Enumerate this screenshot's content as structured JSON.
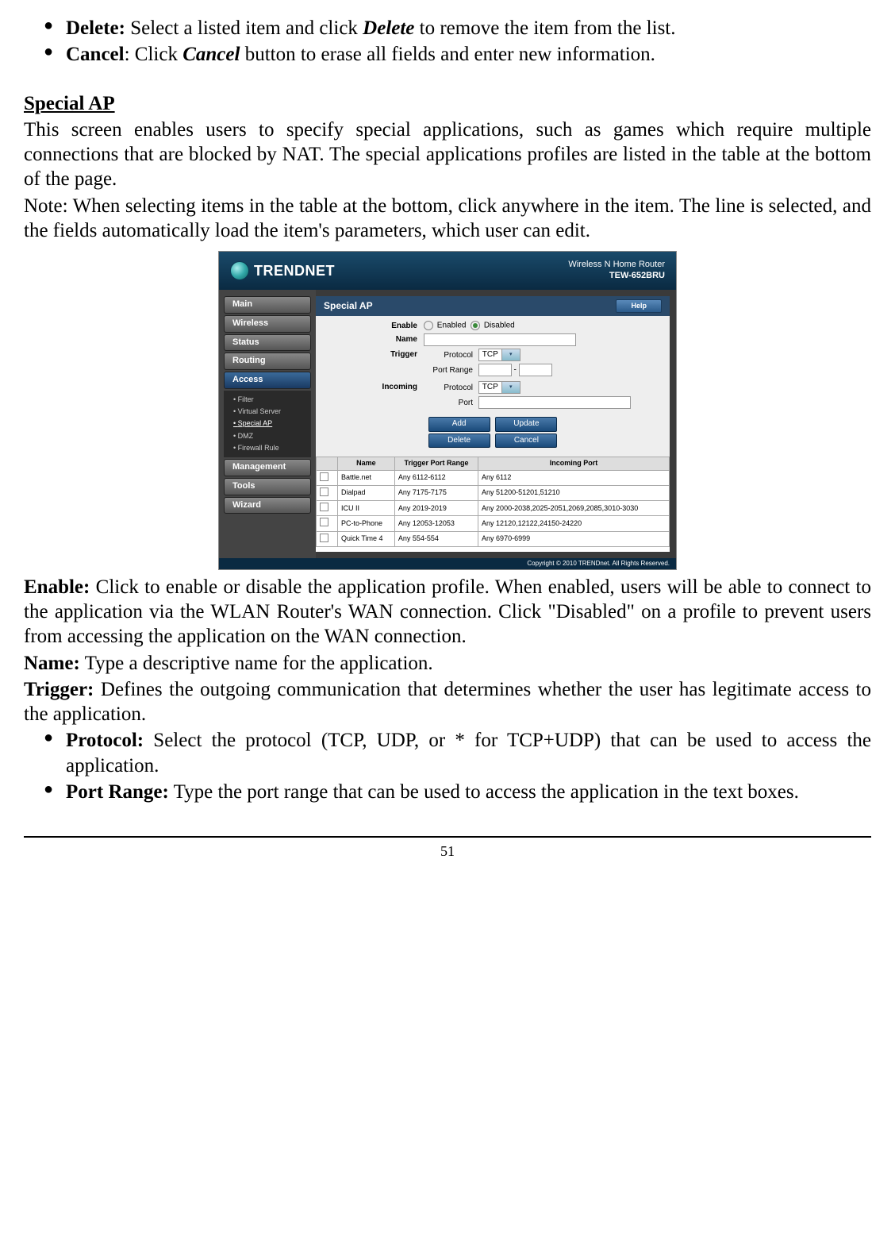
{
  "topBullets": {
    "delete_label": "Delete:",
    "delete_text": " Select a listed item and click ",
    "delete_btn": "Delete",
    "delete_text2": " to remove the item from the list.",
    "cancel_label": "Cancel",
    "cancel_text": ": Click ",
    "cancel_btn": "Cancel",
    "cancel_text2": " button to erase all fields and enter new information."
  },
  "sectionTitle": "Special AP",
  "intro1": "This screen enables users to specify special applications, such as games which require multiple connections that are blocked by NAT. The special applications profiles are listed in the table at the bottom of the page.",
  "intro2": "Note: When selecting items in the table at the bottom, click anywhere in the item. The line is selected, and the fields automatically load the item's parameters, which user can edit.",
  "router": {
    "brand": "TRENDNET",
    "headerLine1": "Wireless N Home Router",
    "headerLine2": "TEW-652BRU",
    "nav": [
      "Main",
      "Wireless",
      "Status",
      "Routing",
      "Access",
      "Management",
      "Tools",
      "Wizard"
    ],
    "subnav": [
      "Filter",
      "Virtual Server",
      "Special AP",
      "DMZ",
      "Firewall Rule"
    ],
    "contentTitle": "Special AP",
    "helpLabel": "Help",
    "form": {
      "enableLabel": "Enable",
      "enabledOpt": "Enabled",
      "disabledOpt": "Disabled",
      "nameLabel": "Name",
      "triggerLabel": "Trigger",
      "incomingLabel": "Incoming",
      "protocolLabel": "Protocol",
      "portRangeLabel": "Port Range",
      "portLabel": "Port",
      "protoValue": "TCP"
    },
    "buttons": {
      "add": "Add",
      "update": "Update",
      "delete": "Delete",
      "cancel": "Cancel"
    },
    "tableHeaders": {
      "name": "Name",
      "trigger": "Trigger Port Range",
      "incoming": "Incoming Port"
    },
    "rows": [
      {
        "name": "Battle.net",
        "trigger": "Any 6112-6112",
        "incoming": "Any 6112"
      },
      {
        "name": "Dialpad",
        "trigger": "Any 7175-7175",
        "incoming": "Any 51200-51201,51210"
      },
      {
        "name": "ICU II",
        "trigger": "Any 2019-2019",
        "incoming": "Any 2000-2038,2025-2051,2069,2085,3010-3030"
      },
      {
        "name": "PC-to-Phone",
        "trigger": "Any 12053-12053",
        "incoming": "Any 12120,12122,24150-24220"
      },
      {
        "name": "Quick Time 4",
        "trigger": "Any 554-554",
        "incoming": "Any 6970-6999"
      }
    ],
    "copyright": "Copyright © 2010 TRENDnet. All Rights Reserved."
  },
  "desc": {
    "enable_label": "Enable:",
    "enable_text": " Click to enable or disable the application profile. When enabled, users will be able to connect to the application via the WLAN Router's WAN connection. Click \"Disabled\" on a profile to prevent users from accessing the application on the WAN connection.",
    "name_label": "Name:",
    "name_text": " Type a descriptive name for the application.",
    "trigger_label": "Trigger:",
    "trigger_text": " Defines the outgoing communication that determines whether the user has legitimate access to the application.",
    "protocol_label": "Protocol:",
    "protocol_text": " Select the protocol (TCP, UDP, or * for TCP+UDP) that can be used to access the application.",
    "portrange_label": "Port Range:",
    "portrange_text": " Type the port range that can be used to access the application in the text boxes."
  },
  "pageNumber": "51"
}
